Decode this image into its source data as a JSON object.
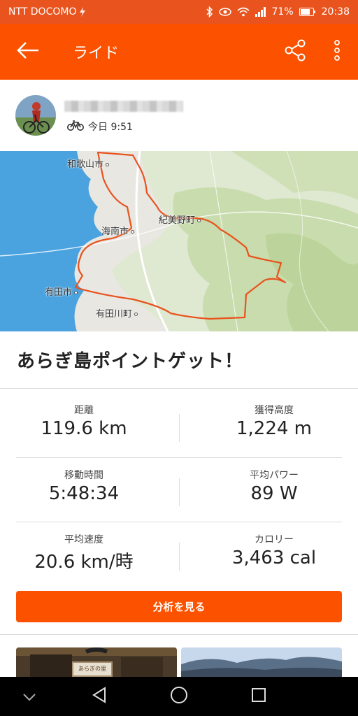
{
  "status_bar": {
    "carrier": "NTT DOCOMO",
    "battery_percent": "71%",
    "time": "20:38"
  },
  "app_bar": {
    "title": "ライド",
    "icons": [
      "back-arrow-icon",
      "share-icon",
      "more-vert-icon"
    ]
  },
  "athlete": {
    "activity_icon": "bike-icon",
    "time_text": "今日 9:51"
  },
  "map": {
    "labels": [
      "和歌山市",
      "紀美野町",
      "海南市",
      "有田市",
      "有田川町"
    ],
    "route_color": "#e8531e"
  },
  "ride": {
    "title": "あらぎ島ポイントゲット！"
  },
  "stats": [
    {
      "label": "距離",
      "value": "119.6 km"
    },
    {
      "label": "獲得高度",
      "value": "1,224 m"
    },
    {
      "label": "移動時間",
      "value": "5:48:34"
    },
    {
      "label": "平均パワー",
      "value": "89 W"
    },
    {
      "label": "平均速度",
      "value": "20.6 km/時"
    },
    {
      "label": "カロリー",
      "value": "3,463 cal"
    }
  ],
  "analysis_button": {
    "label": "分析を見る"
  },
  "photos": {
    "first_sign_text": "あらぎの里"
  },
  "colors": {
    "brand": "#fc5200",
    "status_bar": "#e8531e"
  },
  "nav_bar": {
    "icons": [
      "chevron-down-icon",
      "back-triangle-icon",
      "home-circle-icon",
      "recents-square-icon"
    ]
  }
}
